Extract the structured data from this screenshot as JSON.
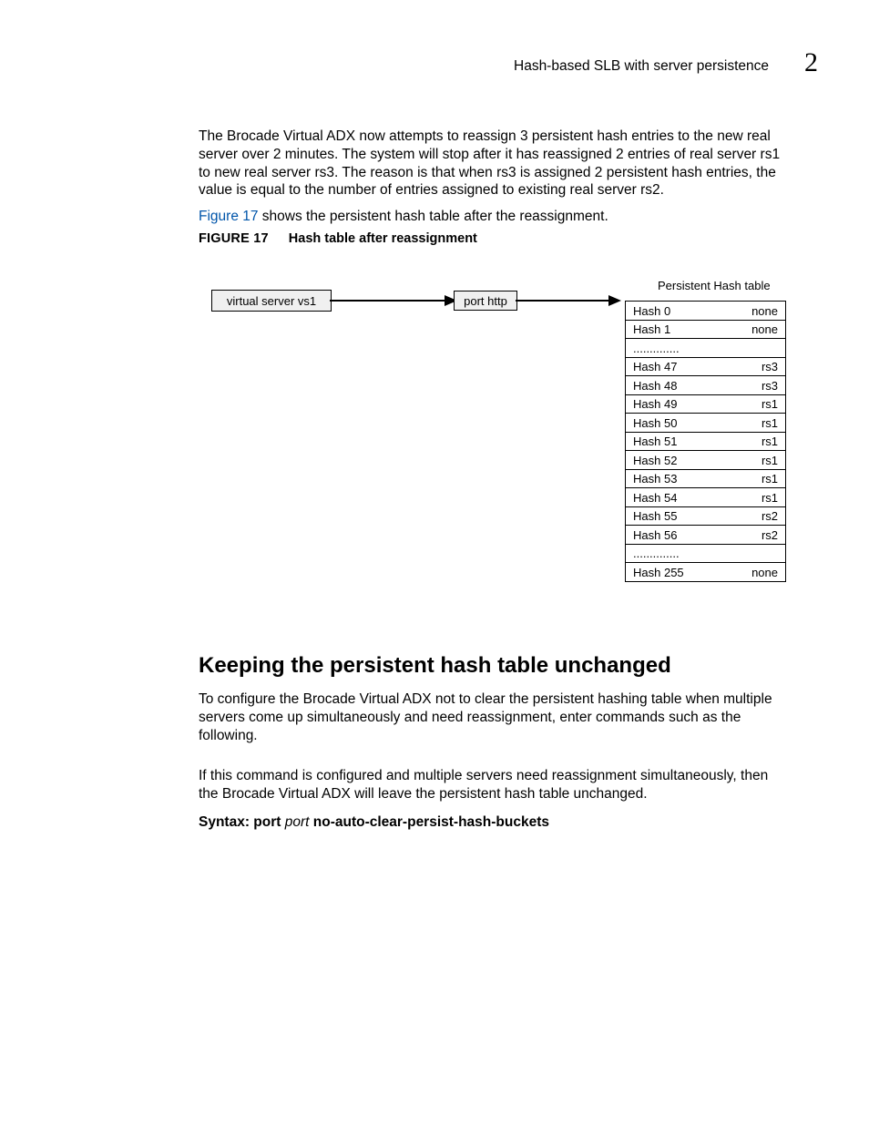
{
  "header": {
    "section_title": "Hash-based SLB with server persistence",
    "page_number": "2"
  },
  "paragraphs": {
    "p1": "The Brocade Virtual ADX now attempts to reassign 3 persistent hash entries to the new real server over 2 minutes. The system will stop after it has reassigned 2 entries of real server rs1 to new real server rs3. The reason is that when rs3 is assigned 2 persistent hash entries, the value is equal to the number of entries assigned to existing real server rs2.",
    "p2_link": "Figure 17",
    "p2_rest": " shows the persistent hash table after the reassignment.",
    "p3": "To configure the Brocade Virtual ADX not to clear the persistent hashing table when multiple servers come up simultaneously and need reassignment, enter commands such as the following.",
    "p4": "If this command is configured and multiple servers need reassignment simultaneously, then the Brocade Virtual ADX will leave the persistent hash table unchanged."
  },
  "figure": {
    "label": "FIGURE 17",
    "title": "Hash table after reassignment",
    "hash_table_title": "Persistent Hash table",
    "vs_box": "virtual server vs1",
    "port_box": "port http",
    "rows": [
      {
        "h": "Hash 0",
        "v": "none"
      },
      {
        "h": "Hash 1",
        "v": "none"
      },
      {
        "h": "..............",
        "v": ""
      },
      {
        "h": "Hash 47",
        "v": "rs3"
      },
      {
        "h": "Hash 48",
        "v": "rs3"
      },
      {
        "h": "Hash 49",
        "v": "rs1"
      },
      {
        "h": "Hash 50",
        "v": "rs1"
      },
      {
        "h": "Hash 51",
        "v": "rs1"
      },
      {
        "h": "Hash 52",
        "v": "rs1"
      },
      {
        "h": "Hash 53",
        "v": "rs1"
      },
      {
        "h": "Hash 54",
        "v": "rs1"
      },
      {
        "h": "Hash 55",
        "v": "rs2"
      },
      {
        "h": "Hash 56",
        "v": "rs2"
      },
      {
        "h": "..............",
        "v": ""
      },
      {
        "h": "Hash 255",
        "v": "none"
      }
    ]
  },
  "subheading": "Keeping the persistent hash table unchanged",
  "syntax": {
    "prefix": "Syntax:  port ",
    "italic": "port",
    "suffix": " no-auto-clear-persist-hash-buckets"
  }
}
